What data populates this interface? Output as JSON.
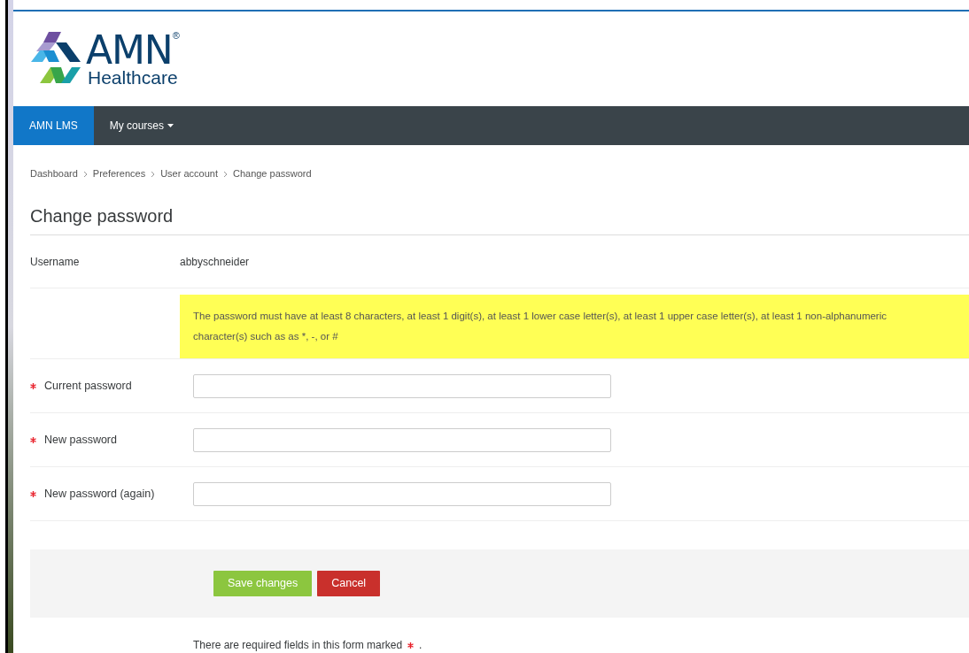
{
  "logo": {
    "name": "AMN",
    "registered": "®",
    "subtitle": "Healthcare"
  },
  "navbar": {
    "items": [
      {
        "label": "AMN LMS",
        "selected": true,
        "dropdown": false
      },
      {
        "label": "My courses",
        "selected": false,
        "dropdown": true
      }
    ]
  },
  "breadcrumb": [
    "Dashboard",
    "Preferences",
    "User account",
    "Change password"
  ],
  "heading": "Change password",
  "username": {
    "label": "Username",
    "value": "abbyschneider"
  },
  "notice": "The password must have at least 8 characters, at least 1 digit(s), at least 1 lower case letter(s), at least 1 upper case letter(s), at least 1 non-alphanumeric character(s) such as as *, -, or #",
  "fields": [
    {
      "label": "Current password",
      "required": true
    },
    {
      "label": "New password",
      "required": true
    },
    {
      "label": "New password (again)",
      "required": true
    }
  ],
  "buttons": [
    {
      "label": "Save changes",
      "kind": "primary"
    },
    {
      "label": "Cancel",
      "kind": "danger"
    }
  ],
  "footnote": {
    "text": "There are required fields in this form marked",
    "end": "."
  }
}
